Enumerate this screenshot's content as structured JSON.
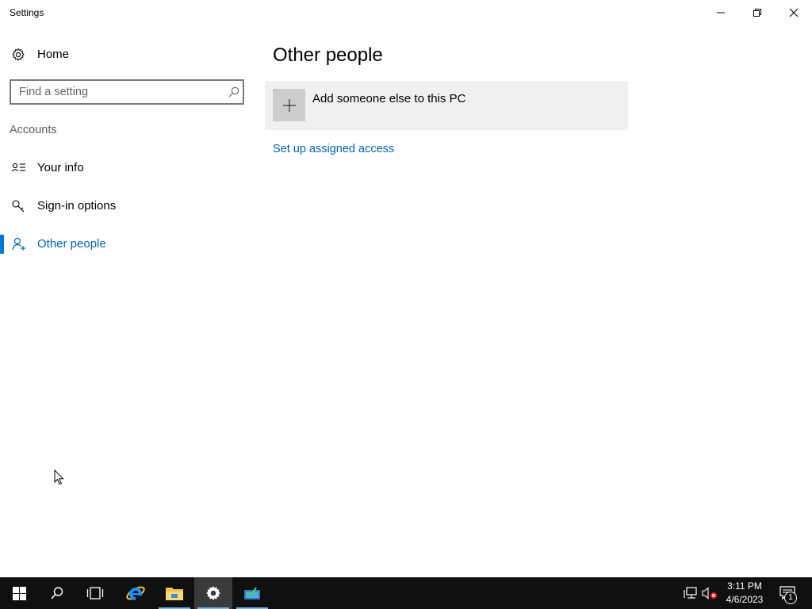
{
  "window": {
    "title": "Settings",
    "controls": {
      "minimize": "minimize",
      "restore": "restore",
      "close": "close"
    }
  },
  "sidebar": {
    "home_label": "Home",
    "search_placeholder": "Find a setting",
    "section_label": "Accounts",
    "items": [
      {
        "label": "Your info",
        "icon": "contact-card-icon",
        "active": false
      },
      {
        "label": "Sign-in options",
        "icon": "key-icon",
        "active": false
      },
      {
        "label": "Other people",
        "icon": "person-add-icon",
        "active": true
      }
    ]
  },
  "main": {
    "page_title": "Other people",
    "add_tile_label": "Add someone else to this PC",
    "assigned_access_link": "Set up assigned access"
  },
  "taskbar": {
    "apps": [
      {
        "name": "start",
        "icon": "windows-logo-icon"
      },
      {
        "name": "search",
        "icon": "search-icon"
      },
      {
        "name": "task-view",
        "icon": "task-view-icon"
      },
      {
        "name": "internet-explorer",
        "icon": "internet-explorer-icon"
      },
      {
        "name": "file-explorer",
        "icon": "folder-icon"
      },
      {
        "name": "settings",
        "icon": "gear-icon"
      },
      {
        "name": "server-manager",
        "icon": "server-manager-icon"
      }
    ],
    "clock_time": "3:11 PM",
    "clock_date": "4/6/2023",
    "notification_count": "1"
  },
  "colors": {
    "accent": "#0078d7",
    "link": "#0063b1",
    "taskbar": "#101010",
    "tile": "#f0f0f0"
  }
}
